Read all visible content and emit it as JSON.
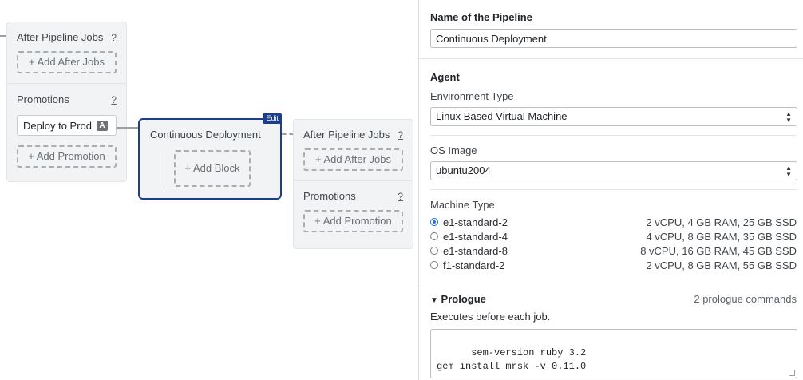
{
  "left_panel": {
    "after_jobs": {
      "title": "After Pipeline Jobs",
      "help": "?",
      "add_label": "+ Add After Jobs"
    },
    "promotions": {
      "title": "Promotions",
      "help": "?",
      "items": [
        {
          "name": "Deploy to Prod",
          "badge": "A"
        }
      ],
      "add_label": "+ Add Promotion"
    }
  },
  "pipeline": {
    "title": "Continuous Deployment",
    "edit_label": "Edit",
    "add_block_label": "+ Add Block"
  },
  "right_panel": {
    "after_jobs": {
      "title": "After Pipeline Jobs",
      "help": "?",
      "add_label": "+ Add After Jobs"
    },
    "promotions": {
      "title": "Promotions",
      "help": "?",
      "add_label": "+ Add Promotion"
    }
  },
  "side": {
    "pipeline_name_label": "Name of the Pipeline",
    "pipeline_name_value": "Continuous Deployment",
    "agent_label": "Agent",
    "env_type_label": "Environment Type",
    "env_type_value": "Linux Based Virtual Machine",
    "os_image_label": "OS Image",
    "os_image_value": "ubuntu2004",
    "machine_type_label": "Machine Type",
    "machines": [
      {
        "name": "e1-standard-2",
        "spec": "2 vCPU, 4 GB RAM, 25 GB SSD",
        "selected": true
      },
      {
        "name": "e1-standard-4",
        "spec": "4 vCPU, 8 GB RAM, 35 GB SSD",
        "selected": false
      },
      {
        "name": "e1-standard-8",
        "spec": "8 vCPU, 16 GB RAM, 45 GB SSD",
        "selected": false
      },
      {
        "name": "f1-standard-2",
        "spec": "2 vCPU, 8 GB RAM, 55 GB SSD",
        "selected": false
      }
    ],
    "prologue_label": "Prologue",
    "prologue_toggle_icon": "triangle-down-icon",
    "prologue_count": "2 prologue commands",
    "prologue_hint": "Executes before each job.",
    "prologue_commands": "sem-version ruby 3.2\ngem install mrsk -v 0.11.0"
  },
  "colors": {
    "selected_border": "#1d3e8a",
    "radio_accent": "#1a73e8"
  }
}
